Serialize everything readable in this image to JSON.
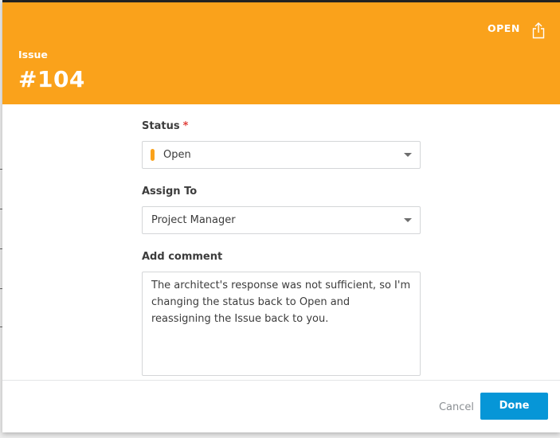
{
  "dialog": {
    "header": {
      "type_label": "Issue",
      "issue_number": "#104",
      "status_text": "OPEN",
      "share_icon": "share-upload-icon",
      "background_color": "#faa21b"
    },
    "form": {
      "status": {
        "label": "Status",
        "required_marker": "*",
        "value": "Open",
        "dot_color": "#faa21b"
      },
      "assign_to": {
        "label": "Assign To",
        "value": "Project Manager"
      },
      "comment": {
        "label": "Add comment",
        "value": "The architect's response was not sufficient, so I'm changing the status back to Open and reassigning the Issue back to you."
      }
    },
    "footer": {
      "cancel_label": "Cancel",
      "done_label": "Done",
      "done_color": "#0696d7"
    }
  }
}
